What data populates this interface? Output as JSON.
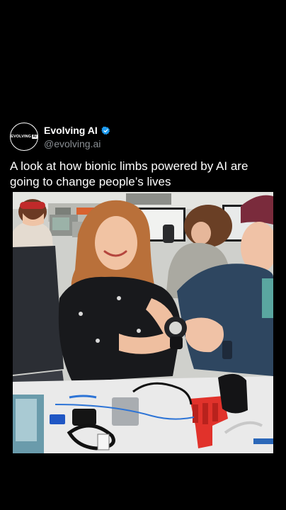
{
  "post": {
    "account_name": "Evolving AI",
    "account_handle": "@evolving.ai",
    "avatar_logo_text": "EVOLVING",
    "avatar_logo_ai": "AI",
    "verified_icon": "verified-badge-icon",
    "caption": "A look at how bionic limbs powered by AI are going to change people’s lives",
    "media": {
      "type": "photo"
    }
  },
  "colors": {
    "background": "#000000",
    "text": "#ffffff",
    "handle": "#8a8f94",
    "verified": "#1d9bf0"
  }
}
